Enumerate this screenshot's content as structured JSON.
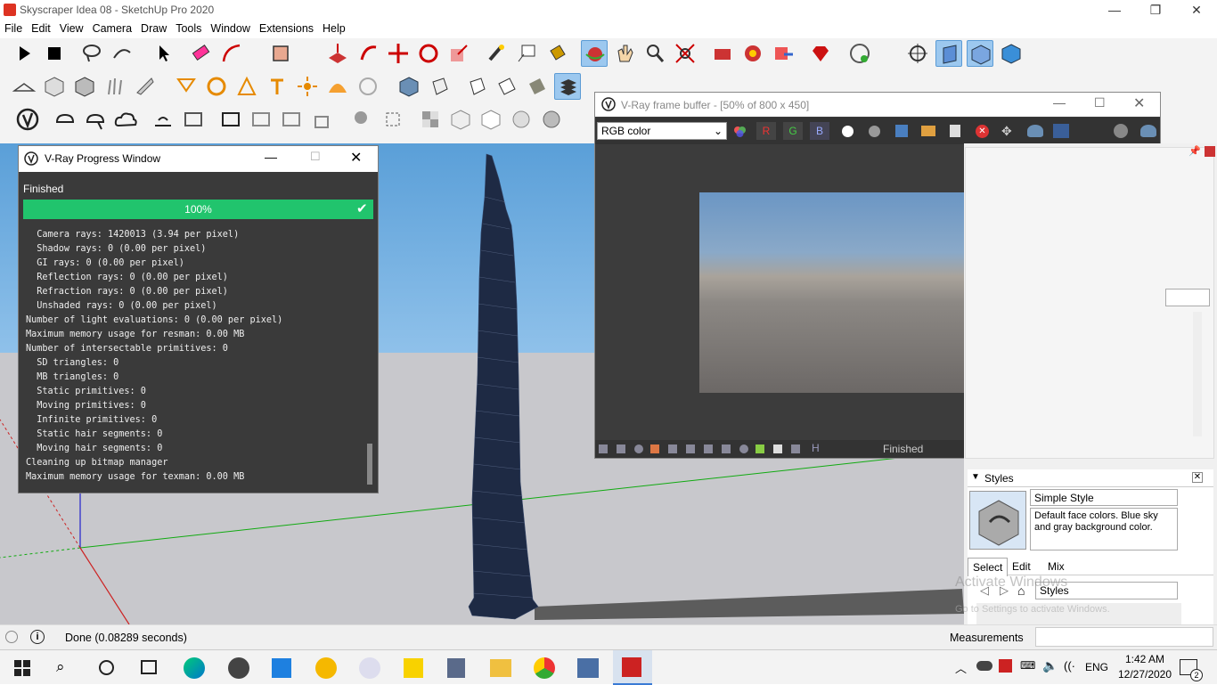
{
  "window": {
    "title": "Skyscraper Idea 08 - SketchUp Pro 2020",
    "min": "—",
    "max": "❐",
    "close": "✕"
  },
  "menu": [
    "File",
    "Edit",
    "View",
    "Camera",
    "Draw",
    "Tools",
    "Window",
    "Extensions",
    "Help"
  ],
  "progress_window": {
    "title": "V-Ray Progress Window",
    "status": "Finished",
    "percent_label": "100%",
    "progress": 1.0,
    "log_lines": [
      "  Camera rays: 1420013 (3.94 per pixel)",
      "  Shadow rays: 0 (0.00 per pixel)",
      "  GI rays: 0 (0.00 per pixel)",
      "  Reflection rays: 0 (0.00 per pixel)",
      "  Refraction rays: 0 (0.00 per pixel)",
      "  Unshaded rays: 0 (0.00 per pixel)",
      "Number of light evaluations: 0 (0.00 per pixel)",
      "Maximum memory usage for resman: 0.00 MB",
      "Number of intersectable primitives: 0",
      "  SD triangles: 0",
      "  MB triangles: 0",
      "  Static primitives: 0",
      "  Moving primitives: 0",
      "  Infinite primitives: 0",
      "  Static hair segments: 0",
      "  Moving hair segments: 0",
      "Cleaning up bitmap manager",
      "Maximum memory usage for texman: 0.00 MB"
    ]
  },
  "vfb": {
    "title": "V-Ray frame buffer - [50% of 800 x 450]",
    "channel": "RGB color",
    "r": "R",
    "g": "G",
    "b": "B",
    "status": "Finished",
    "h_label": "H"
  },
  "styles_panel": {
    "header": "Styles",
    "style_name": "Simple Style",
    "style_desc": "Default face colors. Blue sky and gray background color.",
    "tabs": [
      "Select",
      "Edit",
      "Mix"
    ],
    "library": "Styles"
  },
  "status": {
    "message": "Done (0.08289 seconds)",
    "measurements_label": "Measurements"
  },
  "watermark": {
    "line1": "Activate Windows",
    "line2": "Go to Settings to activate Windows."
  },
  "clock": {
    "time": "1:42 AM",
    "date": "12/27/2020"
  },
  "taskbar": {
    "lang": "ENG",
    "notif_count": "2"
  },
  "colors": {
    "accent_green": "#21c46d",
    "sky": "#5a9fd8",
    "ground": "#c8c8cc"
  }
}
